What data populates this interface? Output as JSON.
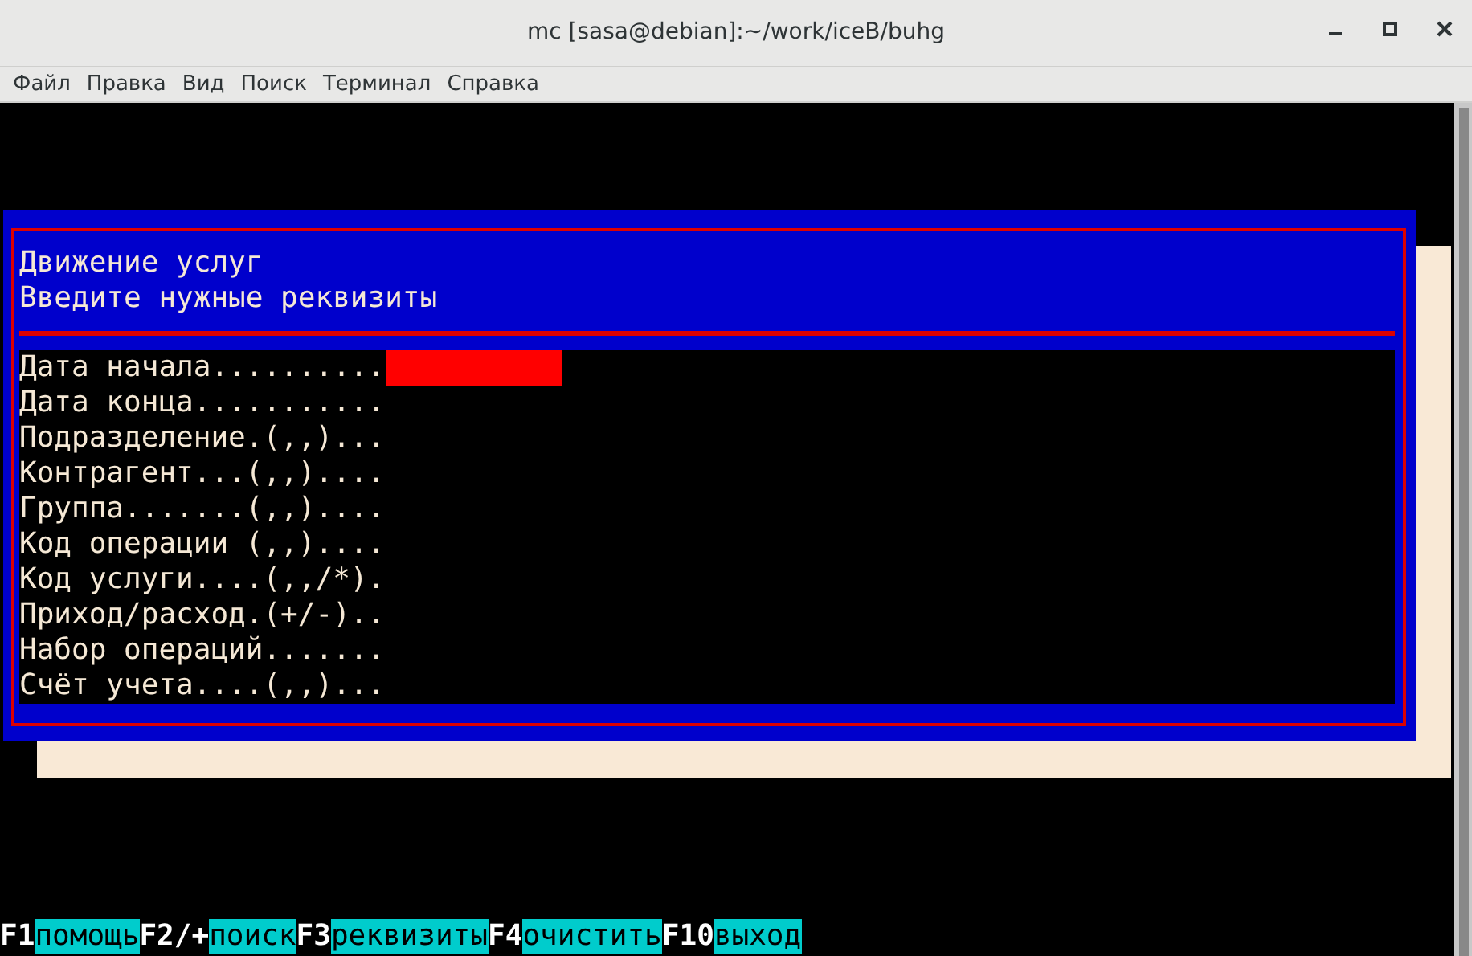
{
  "window": {
    "title": "mc [sasa@debian]:~/work/iceB/buhg"
  },
  "menu": [
    "Файл",
    "Правка",
    "Вид",
    "Поиск",
    "Терминал",
    "Справка"
  ],
  "dialog": {
    "title": "Движение услуг",
    "subtitle": "Введите нужные реквизиты",
    "fields": [
      {
        "label": "Дата начала..........",
        "focused": true
      },
      {
        "label": "Дата конца...........",
        "focused": false
      },
      {
        "label": "Подразделение.(,,)...",
        "focused": false
      },
      {
        "label": "Контрагент...(,,)....",
        "focused": false
      },
      {
        "label": "Группа.......(,,)....",
        "focused": false
      },
      {
        "label": "Код операции (,,)....",
        "focused": false
      },
      {
        "label": "Код услуги....(,,/*).",
        "focused": false
      },
      {
        "label": "Приход/расход.(+/-)..",
        "focused": false
      },
      {
        "label": "Набор операций.......",
        "focused": false
      },
      {
        "label": "Счёт учета....(,,)...",
        "focused": false
      }
    ]
  },
  "function_keys": [
    {
      "key": "F1",
      "label": "помощь"
    },
    {
      "key": "F2/+",
      "label": "поиск"
    },
    {
      "key": "F3",
      "label": "реквизиты"
    },
    {
      "key": "F4",
      "label": "очистить"
    },
    {
      "key": "F10",
      "label": "выход"
    }
  ]
}
